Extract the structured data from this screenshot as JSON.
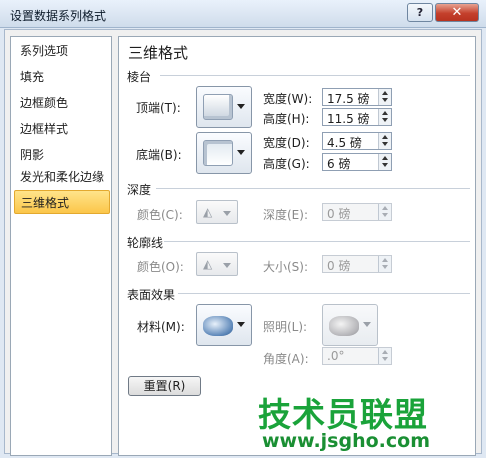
{
  "window": {
    "title": "设置数据系列格式",
    "help_label": "?",
    "close_label": "✕"
  },
  "nav": {
    "items": [
      {
        "label": "系列选项"
      },
      {
        "label": "填充"
      },
      {
        "label": "边框颜色"
      },
      {
        "label": "边框样式"
      },
      {
        "label": "阴影"
      },
      {
        "label": "发光和柔化边缘"
      },
      {
        "label": "三维格式",
        "active": true
      }
    ]
  },
  "panel": {
    "heading": "三维格式",
    "bevel": {
      "section_label": "棱台",
      "top": {
        "label": "顶端(T):",
        "width_label": "宽度(W):",
        "width_value": "17.5 磅",
        "height_label": "高度(H):",
        "height_value": "11.5 磅"
      },
      "bottom": {
        "label": "底端(B):",
        "width_label": "宽度(D):",
        "width_value": "4.5 磅",
        "height_label": "高度(G):",
        "height_value": "6 磅"
      }
    },
    "depth": {
      "section_label": "深度",
      "color_label": "颜色(C):",
      "depth_label": "深度(E):",
      "depth_value": "0 磅"
    },
    "contour": {
      "section_label": "轮廓线",
      "color_label": "颜色(O):",
      "size_label": "大小(S):",
      "size_value": "0 磅"
    },
    "surface": {
      "section_label": "表面效果",
      "material_label": "材料(M):",
      "lighting_label": "照明(L):",
      "angle_label": "角度(A):",
      "angle_value": ".0°"
    },
    "reset_label": "重置(R)"
  },
  "watermark": {
    "text": "技术员联盟",
    "url": "www.jsgho.com"
  },
  "colors": {
    "accent_active": "#fbc64a",
    "watermark_green": "#1aa33a"
  }
}
